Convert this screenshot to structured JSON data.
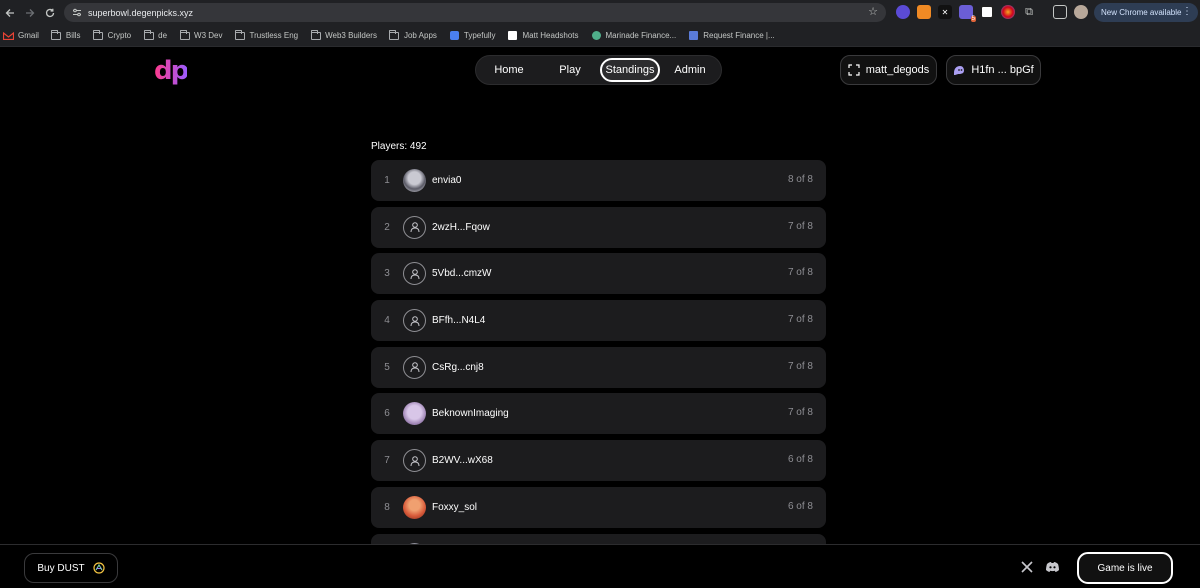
{
  "browser": {
    "url": "superbowl.degenpicks.xyz",
    "new_chrome_label": "New Chrome available",
    "extension_badge": "5",
    "bookmarks": [
      {
        "label": "Gmail",
        "icon": "gmail-icon"
      },
      {
        "label": "Bills",
        "icon": "folder-icon"
      },
      {
        "label": "Crypto",
        "icon": "folder-icon"
      },
      {
        "label": "de",
        "icon": "folder-icon"
      },
      {
        "label": "W3 Dev",
        "icon": "folder-icon"
      },
      {
        "label": "Trustless Eng",
        "icon": "folder-icon"
      },
      {
        "label": "Web3 Builders",
        "icon": "folder-icon"
      },
      {
        "label": "Job Apps",
        "icon": "folder-icon"
      },
      {
        "label": "Typefully",
        "icon": "typefully-icon"
      },
      {
        "label": "Matt Headshots",
        "icon": "page-icon"
      },
      {
        "label": "Marinade Finance...",
        "icon": "marinade-icon"
      },
      {
        "label": "Request Finance |...",
        "icon": "request-icon"
      }
    ]
  },
  "header": {
    "logo_text": "dp",
    "nav": {
      "home": "Home",
      "play": "Play",
      "standings": "Standings",
      "admin": "Admin"
    },
    "active_tab": "Standings",
    "user_label": "matt_degods",
    "wallet_label": "H1fn ... bpGf"
  },
  "standings": {
    "players_label": "Players: 492",
    "rows": [
      {
        "rank": "1",
        "name": "envia0",
        "score": "8 of 8",
        "avatar": "pic1"
      },
      {
        "rank": "2",
        "name": "2wzH...Fqow",
        "score": "7 of 8",
        "avatar": "default"
      },
      {
        "rank": "3",
        "name": "5Vbd...cmzW",
        "score": "7 of 8",
        "avatar": "default"
      },
      {
        "rank": "4",
        "name": "BFfh...N4L4",
        "score": "7 of 8",
        "avatar": "default"
      },
      {
        "rank": "5",
        "name": "CsRg...cnj8",
        "score": "7 of 8",
        "avatar": "default"
      },
      {
        "rank": "6",
        "name": "BeknownImaging",
        "score": "7 of 8",
        "avatar": "pic2"
      },
      {
        "rank": "7",
        "name": "B2WV...wX68",
        "score": "6 of 8",
        "avatar": "default"
      },
      {
        "rank": "8",
        "name": "Foxxy_sol",
        "score": "6 of 8",
        "avatar": "pic3"
      },
      {
        "rank": "",
        "name": "",
        "score": "",
        "avatar": "pic1"
      }
    ]
  },
  "footer": {
    "buy_label": "Buy DUST",
    "live_label": "Game is live"
  },
  "colors": {
    "background": "#000000",
    "row_bg": "#1c1c1e",
    "muted_text": "#8e8e93",
    "logo_gradient_start": "#ff3a8a",
    "logo_gradient_end": "#9b5cff"
  }
}
